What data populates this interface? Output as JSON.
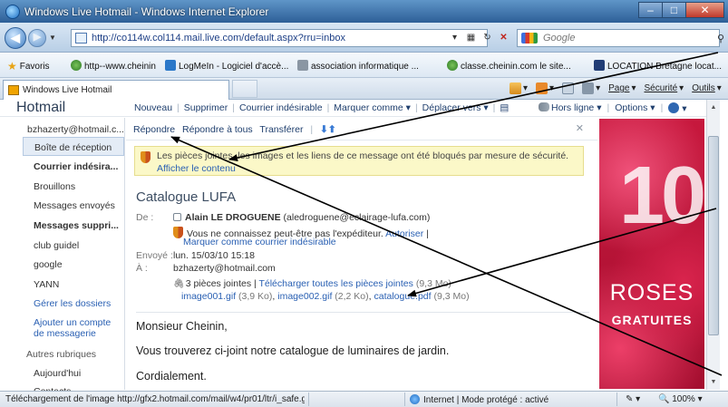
{
  "browser": {
    "window_title": "Windows Live Hotmail - Windows Internet Explorer",
    "url": "http://co114w.col114.mail.live.com/default.aspx?rru=inbox",
    "search_placeholder": "Google",
    "favorites_label": "Favoris",
    "favorites": [
      "http--www.cheinin",
      "LogMeIn - Logiciel d'accè...",
      "association informatique ...",
      "classe.cheinin.com le site...",
      "LOCATION Bretagne locat..."
    ],
    "tab_title": "Windows Live Hotmail",
    "commands": {
      "page": "Page",
      "security": "Sécurité",
      "tools": "Outils"
    },
    "status": {
      "text": "Téléchargement de l'image http://gfx2.hotmail.com/mail/w4/pr01/ltr/i_safe.g",
      "zone": "Internet | Mode protégé : activé",
      "zoom": "100%"
    }
  },
  "app": {
    "brand": "Hotmail",
    "toolbar": [
      "Nouveau",
      "Supprimer",
      "Courrier indésirable",
      "Marquer comme ▾",
      "Déplacer vers ▾"
    ],
    "presence": "Hors ligne ▾",
    "options": "Options ▾"
  },
  "sidebar": {
    "account": "bzhazerty@hotmail.c...",
    "folders": [
      {
        "label": "Boîte de réception",
        "active": true
      },
      {
        "label": "Courrier indésira...",
        "bold": true
      },
      {
        "label": "Brouillons"
      },
      {
        "label": "Messages envoyés"
      },
      {
        "label": "Messages suppri...",
        "bold": true
      },
      {
        "label": "club guidel"
      },
      {
        "label": "google"
      },
      {
        "label": "YANN"
      }
    ],
    "manage_folders": "Gérer les dossiers",
    "add_account": [
      "Ajouter un compte",
      "de messagerie"
    ],
    "other_heading": "Autres rubriques",
    "other_items": [
      "Aujourd'hui",
      "Contacts"
    ]
  },
  "message": {
    "actions": [
      "Répondre",
      "Répondre à tous",
      "Transférer"
    ],
    "warning": "Les pièces jointes, les images et les liens de ce message ont été bloqués par mesure de sécurité.",
    "show_content": "Afficher le contenu",
    "subject": "Catalogue LUFA",
    "labels": {
      "from": "De :",
      "sent": "Envoyé :",
      "to": "À :"
    },
    "from_name": "Alain LE DROGUENE",
    "from_email": "(aledroguene@eclairage-lufa.com)",
    "unknown_sender": "Vous ne connaissez peut-être pas l'expéditeur.",
    "authorize": "Autoriser",
    "mark_junk": "Marquer comme courrier indésirable",
    "sent": "lun. 15/03/10 15:18",
    "to": "bzhazerty@hotmail.com",
    "attachments_count": "3 pièces jointes",
    "download_all": "Télécharger toutes les pièces jointes",
    "download_size": "(9,3 Mo)",
    "files": [
      {
        "name": "image001.gif",
        "size": "(3,9 Ko)"
      },
      {
        "name": "image002.gif",
        "size": "(2,2 Ko)"
      },
      {
        "name": "catalogue.pdf",
        "size": "(9,3 Mo)"
      }
    ],
    "body": [
      "Monsieur Cheinin,",
      "Vous trouverez ci-joint notre catalogue de luminaires de jardin.",
      "Cordialement."
    ]
  },
  "ad": {
    "big": "10",
    "line1": "ROSES",
    "line2": "GRATUITES"
  }
}
